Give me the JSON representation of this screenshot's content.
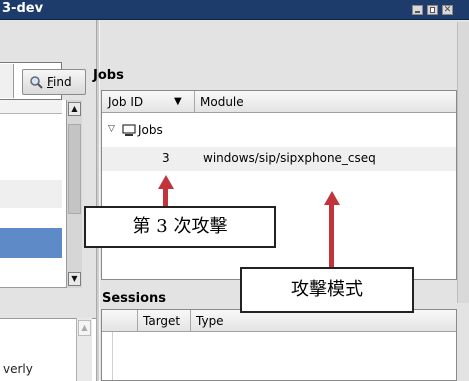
{
  "window": {
    "title": "3-dev"
  },
  "left_pane": {
    "find_label": "Find",
    "partial_text": "verly"
  },
  "jobs": {
    "title": "Jobs",
    "columns": {
      "job_id": "Job ID",
      "module": "Module"
    },
    "tree_label": "Jobs",
    "rows": [
      {
        "id": "3",
        "module": "windows/sip/sipxphone_cseq"
      }
    ]
  },
  "sessions": {
    "title": "Sessions",
    "columns": {
      "target": "Target",
      "type": "Type"
    }
  },
  "annotations": {
    "callout_1": "第 3 次攻擊",
    "callout_2": "攻擊模式",
    "arrow_color": "#c0343a"
  },
  "colors": {
    "titlebar": "#1d3c6b",
    "selection": "#5e8ac7"
  }
}
